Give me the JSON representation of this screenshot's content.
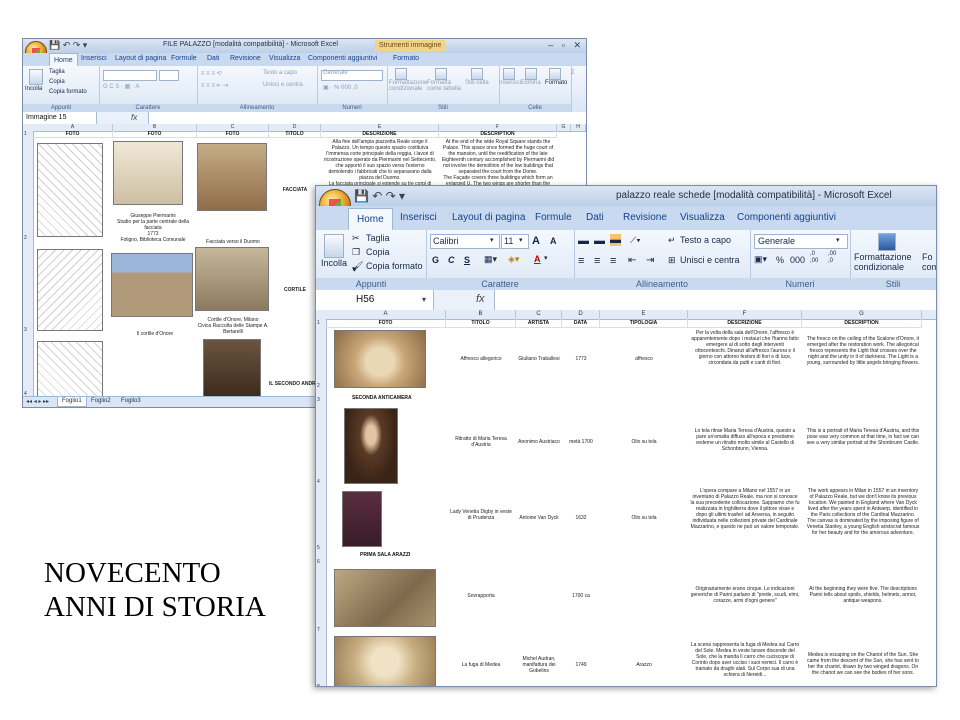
{
  "back_window": {
    "title": "FILE PALAZZO [modalità compatibilità] - Microsoft Excel",
    "context_tab": "Strumenti immagine",
    "tabs": [
      "Home",
      "Inserisci",
      "Layout di pagina",
      "Formule",
      "Dati",
      "Revisione",
      "Visualizza",
      "Componenti aggiuntivi",
      "Formato"
    ],
    "ribbon": {
      "incolla": "Incolla",
      "taglia": "Taglia",
      "copia": "Copia",
      "copia_formato": "Copia formato",
      "appunti": "Appunti",
      "carattere": "Carattere",
      "testo_a_capo": "Testo a capo",
      "unisci_centra": "Unisci e centra",
      "allineamento": "Allineamento",
      "generale": "Generale",
      "numeri": "Numeri",
      "formattazione": "Formattazione condizionale",
      "formatta_tabella": "Formatta come tabella",
      "stili_cella": "Stili cella",
      "stili": "Stili",
      "inserisci": "Inserisci",
      "elimina": "Elimina",
      "formato": "Formato",
      "celle": "Celle"
    },
    "name_box": "Immagine 15",
    "fx": "fx",
    "columns": [
      "A",
      "B",
      "C",
      "D",
      "E",
      "F",
      "G",
      "H"
    ],
    "headers": [
      "FOTO",
      "FOTO",
      "TITOLO",
      "DESCRIZIONE",
      "DESCRIPTION"
    ],
    "rows": [
      "1",
      "2",
      "3",
      "4"
    ],
    "cells": {
      "r2_b": "Giuseppe Piermarini\nStudio per la parte centrale della facciata\n1773\nFoligno, Biblioteca Comunale",
      "r2_c": "Facciata verso il Duomo",
      "r2_d": "FACCIATA",
      "r2_e": "Alla fine dell'ampia piazzetta Reale sorge il Palazzo. Un tempo questo spazio costituiva l'immensa corte principale della reggia, i lavori di ricostruzione operato da Piermarini nel Settecento, che apportò il suo spazio verso l'esterno demolendo i fabbricati che lo separavano dalla piazza del Duomo.\nLa facciata principale si estende su tre corpi di fabbrica che formano una U allargata. Le due ali sono diverse più",
      "r2_f": "At the end of the wide Royal Square stands the Palace. This space once formed the huge court of the mansion, until the reedification of the late Eighteenth century accomplished by Piermarini did not involve the demolition of the low buildings that separated the court from the Dome.\nThe Façade covers three buildings which form an enlarged U. The two wings are shorter than the original",
      "r3_b": "Il cortile d'Onore",
      "r3_c": "Cortile d'Onore, Milano\nCivica Raccolta delle Stampe A. Bertarelli",
      "r3_d": "CORTILE",
      "r4_d": "IL SECONDO ANDRONE"
    },
    "sheet_tabs": [
      "Foglio1",
      "Foglio2",
      "Foglio3"
    ]
  },
  "front_window": {
    "title": "palazzo reale schede  [modalità compatibilità] - Microsoft Excel",
    "tabs": [
      "Home",
      "Inserisci",
      "Layout di pagina",
      "Formule",
      "Dati",
      "Revisione",
      "Visualizza",
      "Componenti aggiuntivi"
    ],
    "ribbon": {
      "incolla": "Incolla",
      "taglia": "Taglia",
      "copia": "Copia",
      "copia_formato": "Copia formato",
      "appunti": "Appunti",
      "font": "Calibri",
      "size": "11",
      "grow": "A",
      "shrink": "A",
      "bold": "G",
      "italic": "C",
      "underline": "S",
      "carattere": "Carattere",
      "testo_a_capo": "Testo a capo",
      "unisci_centra": "Unisci e centra",
      "allineamento": "Allineamento",
      "generale": "Generale",
      "percent": "%",
      "thousands": "000",
      "dec_inc": ",0\n,00",
      "dec_dec": ",00\n,0",
      "numeri": "Numeri",
      "formattazione": "Formattazione\ncondizionale",
      "formatta_come": "Fo\ncome",
      "stili": "Stili"
    },
    "name_box": "H56",
    "fx": "fx",
    "columns": [
      "A",
      "B",
      "C",
      "D",
      "E",
      "F",
      "G"
    ],
    "headers": [
      "FOTO",
      "TITOLO",
      "ARTISTA",
      "DATA",
      "TIPOLOGIA",
      "DESCRIZIONE",
      "DESCRIPTION"
    ],
    "rows": [
      "1",
      "2",
      "3",
      "4",
      "5",
      "6",
      "7",
      "8"
    ],
    "sections": {
      "seconda": "SECONDA ANTICAMERA",
      "prima": "PRIMA SALA ARAZZI"
    },
    "records": [
      {
        "titolo": "Affresco allegorico",
        "artista": "Giuliano Traballesi",
        "data": "1773",
        "tipologia": "affresco",
        "descrizione": "Per la volta della sala dell'Onore, l'affresco è apparentemente dopo i restauri che l'hanno fatto emergere al di sotto degli interventi ottocenteschi. Dinanzi all'affresco l'aurora e il giorno con attorno festoni di fiori e di luce, circondata da putti e canti di fiori.",
        "description": "The fresco on the ceiling of the Scalone d'Onore, it emerged after the restoration work. The allegorical fresco represents the Light that crosses over the night and the unity in it of darkness. The Light is a young, surrounded by little angels bringing flowers."
      },
      {
        "titolo": "Ritratto di Maria Teresa d'Austria",
        "artista": "Anonimo Austriaco",
        "data": "metà 1700",
        "tipologia": "Olio su tela",
        "descrizione": "Lo tela ritrae Maria Teresa d'Austria, questo a pare un'emalta diffuso all'epoca e prestiamo vederne un ritratto molto simile al Castello di Schonbrunn, Vienna.",
        "description": "This is a portrait of Maria Teresa d'Austria, and this pose was very common at that time, in fact we can see a very similar portrait at the Shonbrunn Castle."
      },
      {
        "titolo": "Lady Venetia Digby in veste di Prudenza",
        "artista": "Antoine Van Dyck",
        "data": "1632",
        "tipologia": "Olio su tela",
        "descrizione": "L'opera compare a Milano nel 1557 in un inventario di Palazzo Reale, ma non si conosce la sua precedente collocazione. Sappiamo che fu realizzata in Inghilterra dove il pittore visse e dopo gli ultimi trasferì ad Anversa, in seguito individuata nelle collezioni private del Cardinale Mazzarino, e questo ne può un valore temporale.",
        "description": "The work appears in Milan in 1557 in an inventory of Palazzo Reale, but we don't know its previous location. We painted in England where Van Dyck lived after the years spent in Antwerp, identified in the Paris collections of the Cardinal Mazzarino. The canvas is dominated by the imposing figure of Venetia Stanley, a young English aristocrat famous for her beauty and for the amorous adventure."
      },
      {
        "titolo": "Sovrapporta",
        "artista": "",
        "data": "1700 ca",
        "tipologia": "",
        "descrizione": "Originariamente erano cinque. Le indicazioni generiche di Parini parlano di \"prede, scudi, elmi, corazze, armi d'ogni genere\"",
        "description": "At the beginning they were five. The descriptions Parini tells about spoils, shields, helmets, armor, antique weapons."
      },
      {
        "titolo": "La fuga di Medea",
        "artista": "Michel Audran, manifattura dei Gobelins",
        "data": "1749",
        "tipologia": "Arazzo",
        "descrizione": "La scena rappresenta la fuga di Medea sul Carro del Sole. Medea in veste lunare discende del Sole, che la manda lì carro che cuciscope di Corinto dopo aver ucciso i suoi nemici. Il carro è trainato da draghi alati. Sul Corpo sua di una schiera di Nereidi...",
        "description": "Medea is escaping on the Chariot of the Sun. She came from the descent of the Sun, she has sent to her the chariot, drawn by two winged dragons. On the chariot we can see the bodies of her sons."
      }
    ]
  },
  "caption": {
    "line1": "NOVECENTO",
    "line2": "ANNI DI STORIA"
  },
  "colors": {
    "ribbon_blue": "#15428b",
    "title_gradient_top": "#dbe6f4",
    "context_tab": "#f1d38a"
  }
}
